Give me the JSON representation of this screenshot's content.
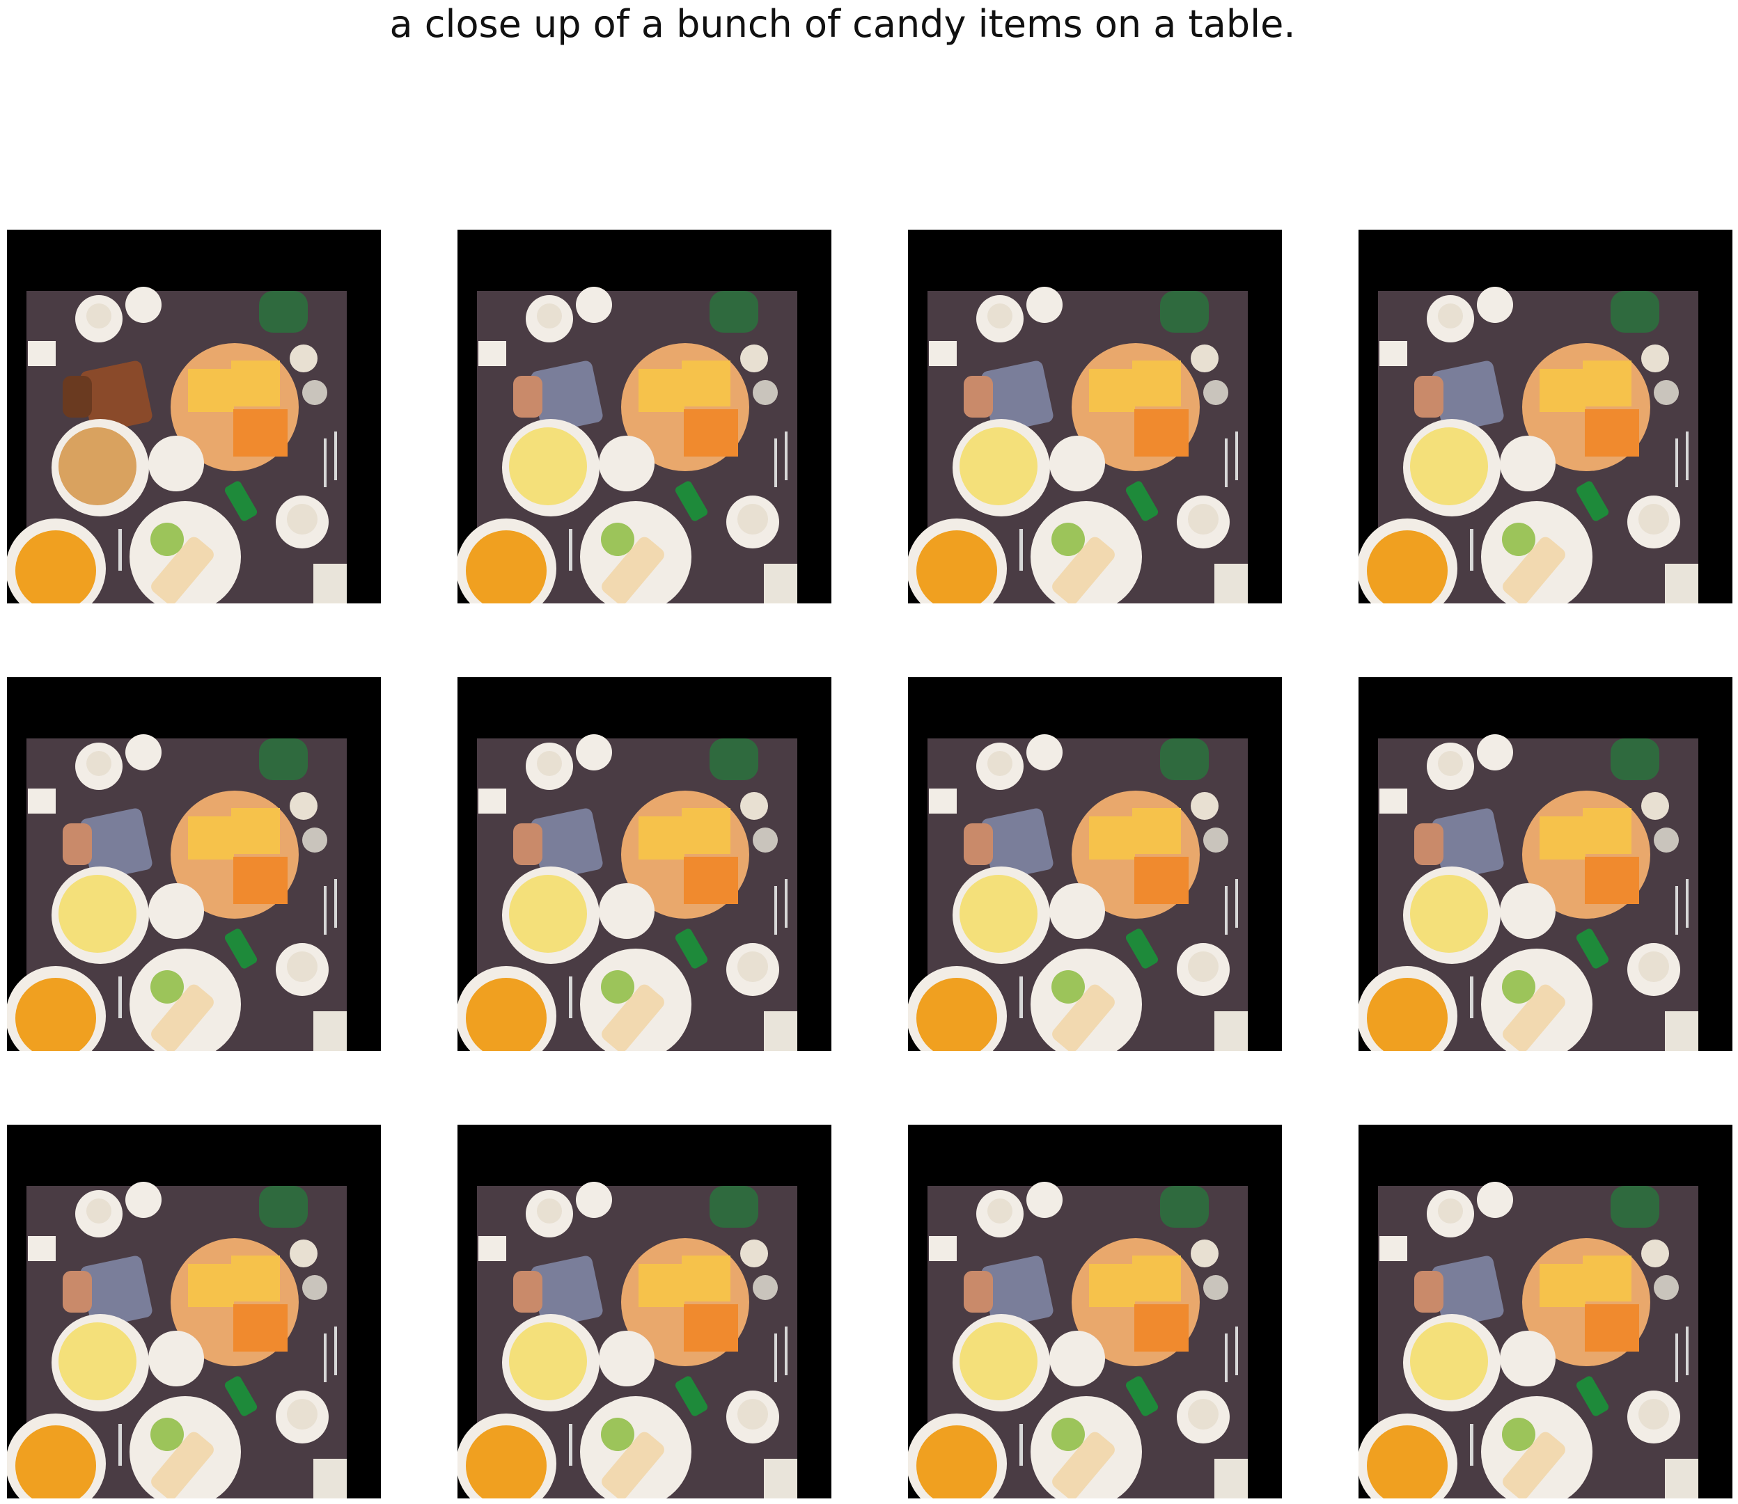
{
  "caption": "a close up of a bunch of candy items on a table.",
  "grid": {
    "rows": 3,
    "columns": 4
  },
  "colors": {
    "frame": "#000000",
    "table": "#4a3c44",
    "plate": "#f2ede6",
    "cheese_board": "#e9a86c",
    "cheese": "#f6c24b",
    "orange_cheese": "#f08a2e",
    "pancake": "#d9a25f",
    "fruit": "#f0a020",
    "bread": "#8a4a2a",
    "cup": "#e8e0d2",
    "can": "#1e8a3a",
    "bottle": "#2f6a3e"
  },
  "tiles": [
    {
      "id": "r1c1",
      "variant": "original"
    },
    {
      "id": "r1c2",
      "variant": "edited"
    },
    {
      "id": "r1c3",
      "variant": "edited"
    },
    {
      "id": "r1c4",
      "variant": "edited"
    },
    {
      "id": "r2c1",
      "variant": "edited"
    },
    {
      "id": "r2c2",
      "variant": "edited"
    },
    {
      "id": "r2c3",
      "variant": "edited"
    },
    {
      "id": "r2c4",
      "variant": "edited"
    },
    {
      "id": "r3c1",
      "variant": "edited"
    },
    {
      "id": "r3c2",
      "variant": "edited"
    },
    {
      "id": "r3c3",
      "variant": "edited"
    },
    {
      "id": "r3c4",
      "variant": "edited"
    }
  ]
}
